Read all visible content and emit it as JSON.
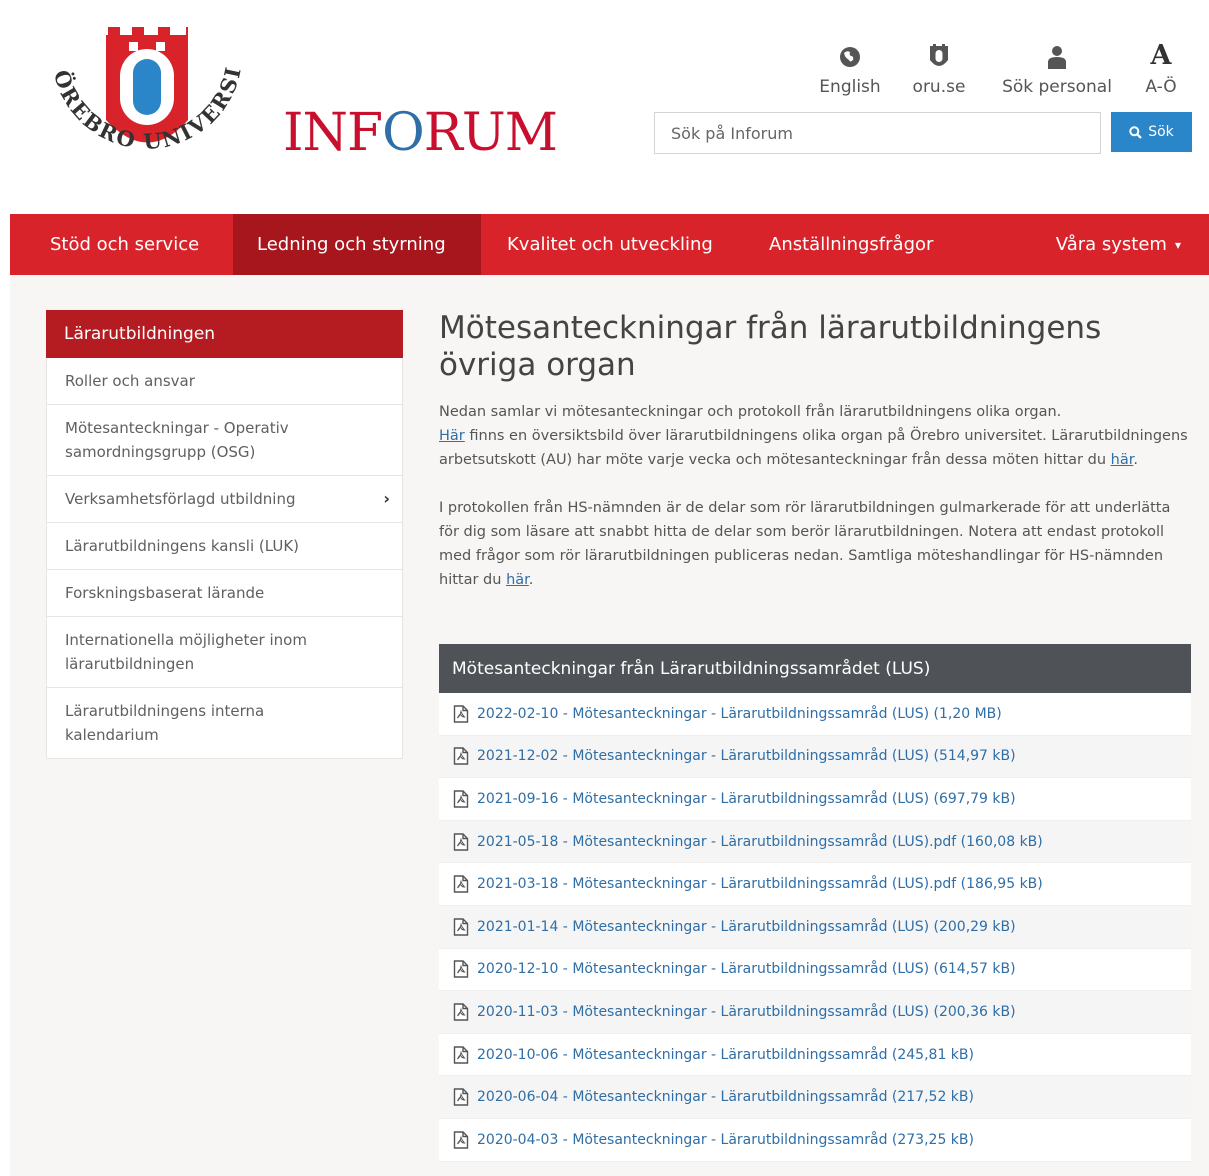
{
  "brand": {
    "logo_text": "ÖREBRO UNIVERSITET",
    "site_name_part1": "INF",
    "site_name_part2": "O",
    "site_name_part3": "RUM"
  },
  "quick_links": [
    {
      "label": "English",
      "icon": "globe-icon"
    },
    {
      "label": "oru.se",
      "icon": "oru-shield-icon"
    },
    {
      "label": "Sök personal",
      "icon": "person-icon"
    },
    {
      "label": "A-Ö",
      "icon": "a-z-icon"
    }
  ],
  "quick_link_az_glyph": "A",
  "search": {
    "placeholder": "Sök på Inforum",
    "button_label": "Sök"
  },
  "nav": {
    "items": [
      {
        "label": "Stöd och service"
      },
      {
        "label": "Ledning och styrning",
        "active": true
      },
      {
        "label": "Kvalitet och utveckling"
      },
      {
        "label": "Anställningsfrågor"
      },
      {
        "label": "Våra system"
      }
    ]
  },
  "sidebar": {
    "title": "Lärarutbildningen",
    "items": [
      {
        "label": "Roller och ansvar"
      },
      {
        "label": "Mötesanteckningar - Operativ samordningsgrupp (OSG)"
      },
      {
        "label": "Verksamhetsförlagd utbildning",
        "has_children": true
      },
      {
        "label": "Lärarutbildningens kansli (LUK)"
      },
      {
        "label": "Forskningsbaserat lärande"
      },
      {
        "label": "Internationella möjligheter inom lärarutbildningen"
      },
      {
        "label": "Lärarutbildningens interna kalendarium"
      }
    ]
  },
  "main": {
    "title": "Mötesanteckningar från lärarutbildningens övriga organ",
    "intro": {
      "line1": "Nedan samlar vi mötesanteckningar och protokoll från lärarutbildningens olika organ.",
      "link1": "Här",
      "line2": " finns en översiktsbild över lärarutbildningens olika organ på Örebro universitet. Lärarutbildningens arbetsutskott (AU) har möte varje vecka och mötesanteckningar från dessa möten hittar du ",
      "link2": "här",
      "end": "."
    },
    "intro2": {
      "text": "I protokollen från HS-nämnden är de delar som rör lärarutbildningen gulmarkerade för att underlätta för dig som läsare att snabbt hitta de delar som berör lärarutbildningen. Notera att endast protokoll med frågor som rör lärarutbildningen publiceras nedan. Samtliga möteshandlingar för HS-nämnden hittar du ",
      "link": "här",
      "end": "."
    },
    "documents": {
      "heading": "Mötesanteckningar från Lärarutbildningssamrådet (LUS)",
      "items": [
        {
          "label": "2022-02-10 - Mötesanteckningar - Lärarutbildningssamråd (LUS) (1,20 MB)"
        },
        {
          "label": "2021-12-02 - Mötesanteckningar - Lärarutbildningssamråd (LUS) (514,97 kB)"
        },
        {
          "label": "2021-09-16 - Mötesanteckningar - Lärarutbildningssamråd (LUS) (697,79 kB)"
        },
        {
          "label": "2021-05-18 - Mötesanteckningar - Lärarutbildningssamråd (LUS).pdf (160,08 kB)"
        },
        {
          "label": "2021-03-18 - Mötesanteckningar - Lärarutbildningssamråd (LUS).pdf (186,95 kB)"
        },
        {
          "label": "2021-01-14 - Mötesanteckningar - Lärarutbildningssamråd (LUS) (200,29 kB)"
        },
        {
          "label": "2020-12-10 - Mötesanteckningar - Lärarutbildningssamråd (LUS) (614,57 kB)"
        },
        {
          "label": "2020-11-03 - Mötesanteckningar - Lärarutbildningssamråd (LUS) (200,36 kB)"
        },
        {
          "label": "2020-10-06 - Mötesanteckningar - Lärarutbildningssamråd (245,81 kB)"
        },
        {
          "label": "2020-06-04 - Mötesanteckningar - Lärarutbildningssamråd (217,52 kB)"
        },
        {
          "label": "2020-04-03 - Mötesanteckningar - Lärarutbildningssamråd (273,25 kB)"
        }
      ]
    }
  },
  "colors": {
    "brand_red": "#d8232a",
    "nav_active": "#a8161d",
    "sidebar_title_bg": "#b51c22",
    "link_blue": "#2f6ea6",
    "search_button_bg": "#2a85c9",
    "panel_header_bg": "#4f5256"
  }
}
